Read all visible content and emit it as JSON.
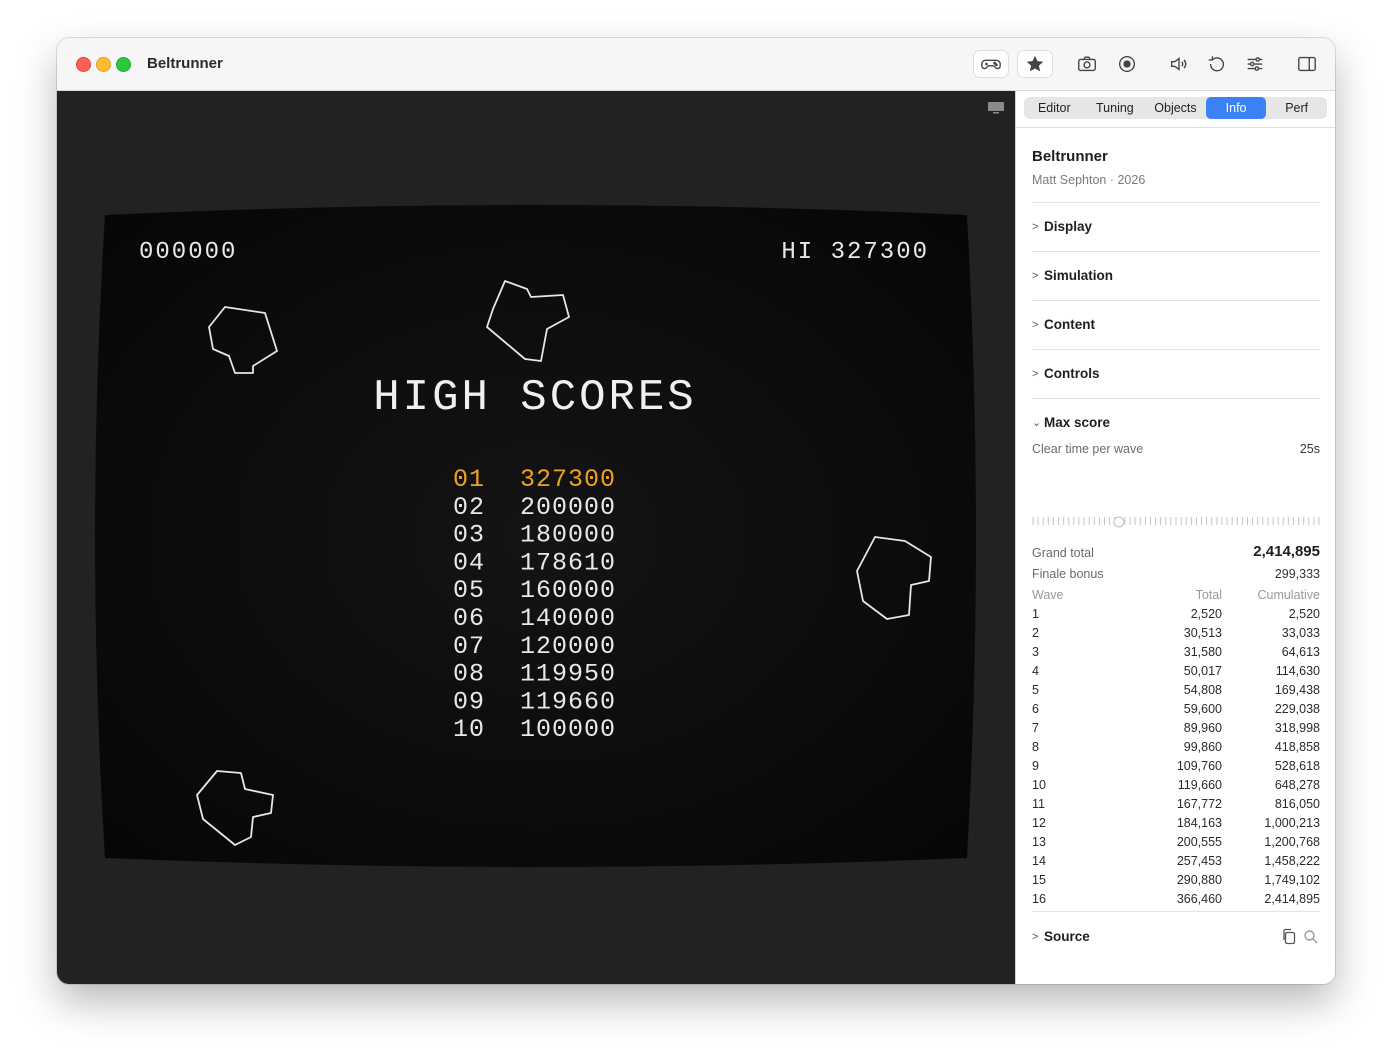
{
  "window": {
    "title": "Beltrunner"
  },
  "toolbar": {
    "icons": [
      "gamepad-icon",
      "star-icon",
      "camera-icon",
      "record-icon",
      "speaker-icon",
      "undo-icon",
      "sliders-icon",
      "sidebar-icon"
    ]
  },
  "game": {
    "score": "000000",
    "hi_label": "HI 327300",
    "heading": "HIGH SCORES",
    "high_scores": [
      {
        "rank": "01",
        "score": "327300",
        "highlight": true
      },
      {
        "rank": "02",
        "score": "200000"
      },
      {
        "rank": "03",
        "score": "180000"
      },
      {
        "rank": "04",
        "score": "178610"
      },
      {
        "rank": "05",
        "score": "160000"
      },
      {
        "rank": "06",
        "score": "140000"
      },
      {
        "rank": "07",
        "score": "120000"
      },
      {
        "rank": "08",
        "score": "119950"
      },
      {
        "rank": "09",
        "score": "119660"
      },
      {
        "rank": "10",
        "score": "100000"
      }
    ],
    "highlight_color": "#f0a020",
    "vector_color": "#e8e8e8"
  },
  "sidebar": {
    "tabs": [
      {
        "label": "Editor"
      },
      {
        "label": "Tuning"
      },
      {
        "label": "Objects"
      },
      {
        "label": "Info",
        "active": true
      },
      {
        "label": "Perf"
      }
    ],
    "game_name": "Beltrunner",
    "game_meta": "Matt Sephton · 2026",
    "sections": {
      "display": "Display",
      "simulation": "Simulation",
      "content": "Content",
      "controls": "Controls",
      "max_score": "Max score",
      "source": "Source"
    },
    "max_score": {
      "clear_time_label": "Clear time per wave",
      "clear_time_value": "25s",
      "slider_fraction": 0.3,
      "grand_total_label": "Grand total",
      "grand_total_value": "2,414,895",
      "finale_bonus_label": "Finale bonus",
      "finale_bonus_value": "299,333",
      "columns": [
        "Wave",
        "Total",
        "Cumulative"
      ],
      "rows": [
        [
          "1",
          "2,520",
          "2,520"
        ],
        [
          "2",
          "30,513",
          "33,033"
        ],
        [
          "3",
          "31,580",
          "64,613"
        ],
        [
          "4",
          "50,017",
          "114,630"
        ],
        [
          "5",
          "54,808",
          "169,438"
        ],
        [
          "6",
          "59,600",
          "229,038"
        ],
        [
          "7",
          "89,960",
          "318,998"
        ],
        [
          "8",
          "99,860",
          "418,858"
        ],
        [
          "9",
          "109,760",
          "528,618"
        ],
        [
          "10",
          "119,660",
          "648,278"
        ],
        [
          "11",
          "167,772",
          "816,050"
        ],
        [
          "12",
          "184,163",
          "1,000,213"
        ],
        [
          "13",
          "200,555",
          "1,200,768"
        ],
        [
          "14",
          "257,453",
          "1,458,222"
        ],
        [
          "15",
          "290,880",
          "1,749,102"
        ],
        [
          "16",
          "366,460",
          "2,414,895"
        ]
      ]
    }
  }
}
